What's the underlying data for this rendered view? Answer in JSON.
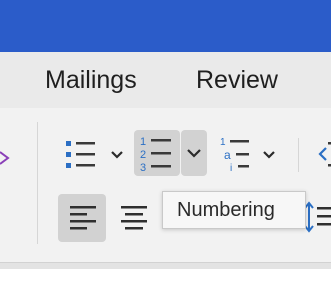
{
  "tabs": [
    {
      "label": "Mailings"
    },
    {
      "label": "Review"
    }
  ],
  "tooltip": {
    "text": "Numbering"
  },
  "icons": {
    "bullets": "bulleted-list-icon",
    "numbering": "numbered-list-icon",
    "multilevel": "multilevel-list-icon",
    "align_left": "align-left-icon",
    "align_center": "align-center-icon",
    "line_spacing": "line-spacing-icon",
    "dropdown": "chevron-down-icon"
  },
  "numbering_icon_digits": [
    "1",
    "2",
    "3"
  ],
  "multilevel_icon_glyphs": [
    "1",
    "a",
    "i"
  ],
  "colors": {
    "title_bar": "#2b5cc9",
    "icon_blue": "#2b6fc4",
    "purple_accent": "#8a3fb8",
    "pressed_bg": "#d2d2d2"
  }
}
